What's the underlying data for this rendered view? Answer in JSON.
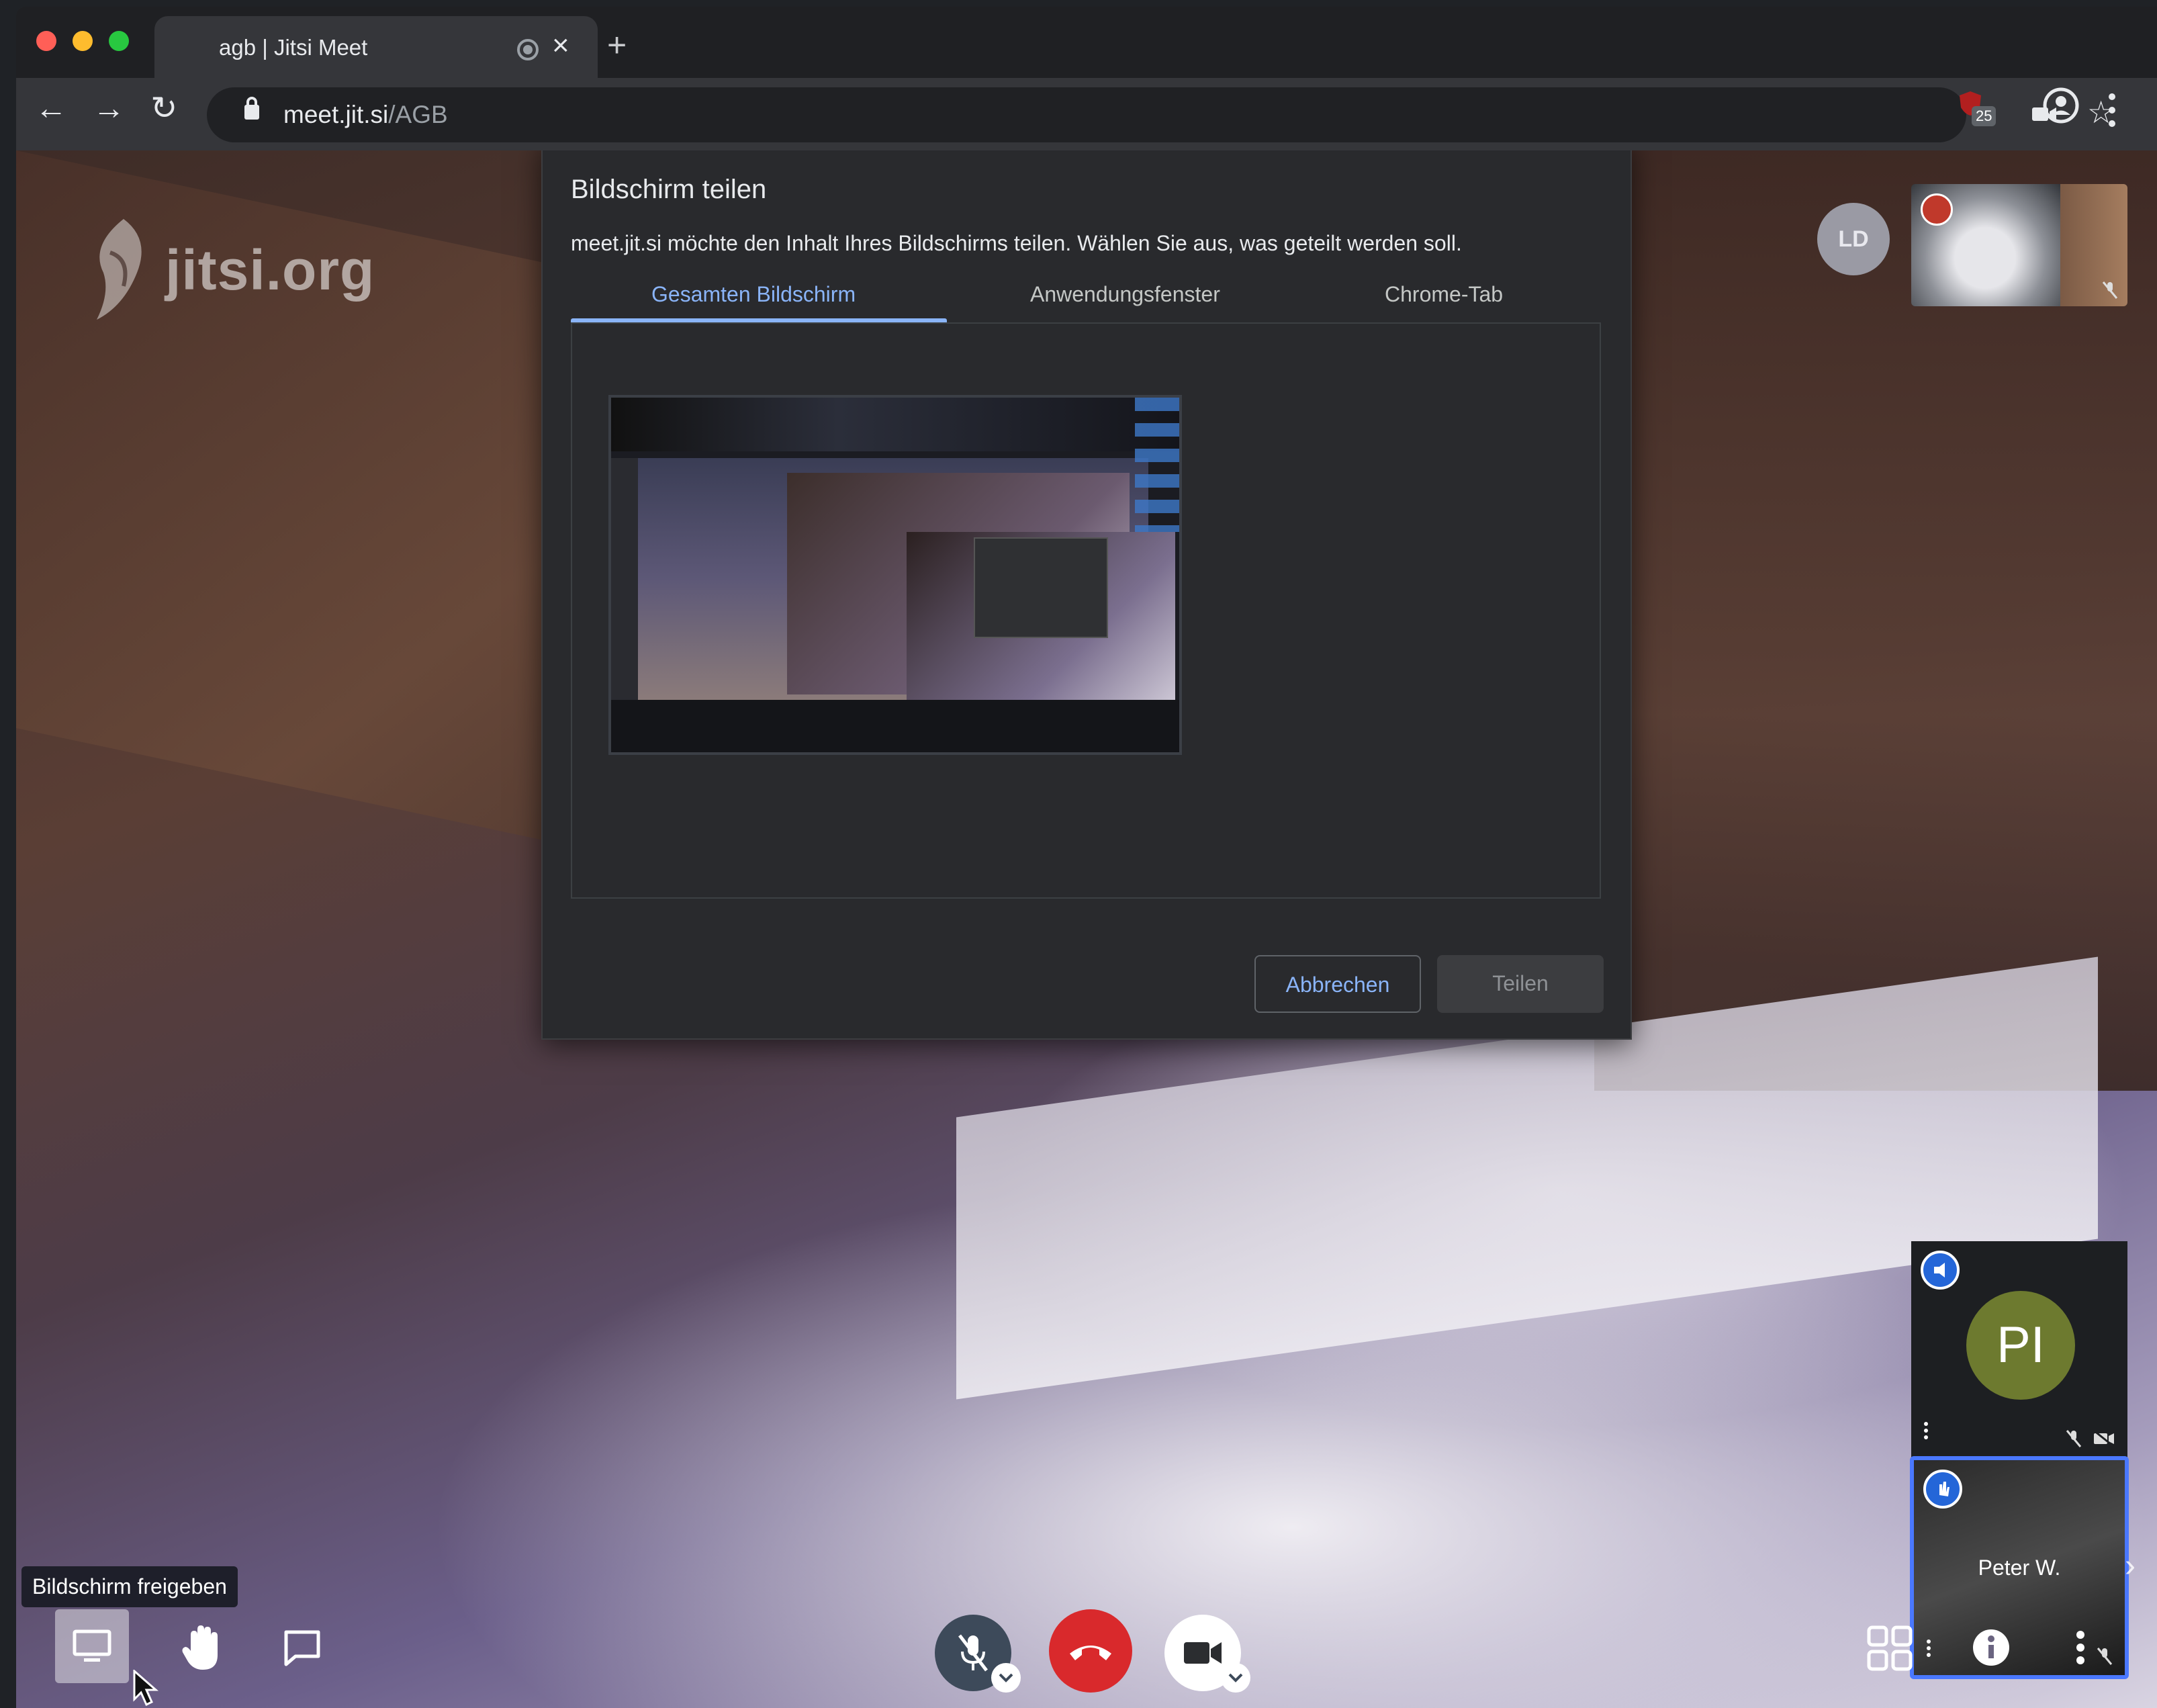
{
  "browser": {
    "tab_title": "agb | Jitsi Meet",
    "tab_close": "×",
    "new_tab": "+",
    "nav_back": "←",
    "nav_forward": "→",
    "nav_reload": "↻",
    "url_host": "meet.jit.si",
    "url_path": "/AGB",
    "extension_badge": "25",
    "star": "☆"
  },
  "jitsi": {
    "logo_text": "jitsi.org"
  },
  "dialog": {
    "title": "Bildschirm teilen",
    "description": "meet.jit.si möchte den Inhalt Ihres Bildschirms teilen. Wählen Sie aus, was geteilt werden soll.",
    "tabs": [
      {
        "label": "Gesamten Bildschirm",
        "active": true
      },
      {
        "label": "Anwendungsfenster",
        "active": false
      },
      {
        "label": "Chrome-Tab",
        "active": false
      }
    ],
    "cancel_label": "Abbrechen",
    "share_label": "Teilen"
  },
  "filmstrip": {
    "avatar_ld": "LD",
    "pi_initials": "PI",
    "peter_name": "Peter W.",
    "toggle": "›"
  },
  "toolbox": {
    "tooltip": "Bildschirm freigeben"
  },
  "colors": {
    "accent": "#8ab4f8",
    "hangup": "#d9292c",
    "dominant_speaker": "#2466d8",
    "active_tile_border": "#4a78ff"
  }
}
